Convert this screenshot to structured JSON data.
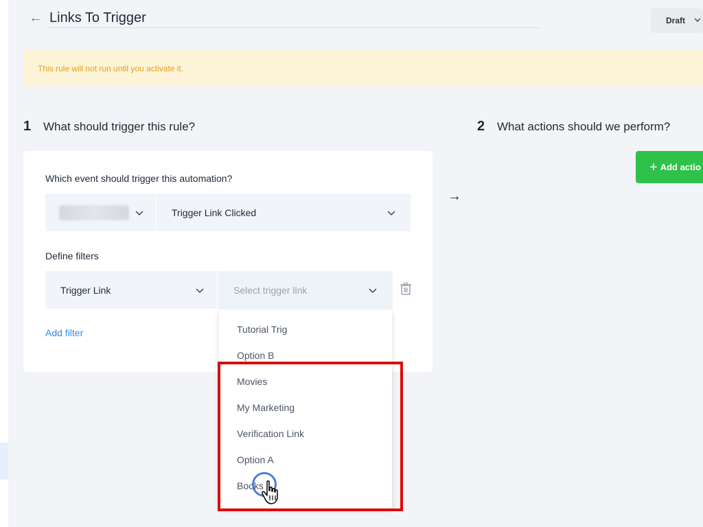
{
  "header": {
    "title": "Links To Trigger",
    "status": {
      "selected": "Draft"
    }
  },
  "banner": {
    "text": "This rule will not run until you activate it."
  },
  "step1": {
    "number": "1",
    "title": "What should trigger this rule?",
    "event_label": "Which event should trigger this automation?",
    "event_select": {
      "selected": "Trigger Link Clicked"
    },
    "filters_label": "Define filters",
    "filter": {
      "field": "Trigger Link",
      "value_placeholder": "Select trigger link"
    },
    "add_filter": "Add filter"
  },
  "step2": {
    "number": "2",
    "title": "What actions should we perform?",
    "add_action": "Add actio"
  },
  "dropdown": {
    "items": [
      "Tutorial Trig",
      "Option B",
      "Movies",
      "My Marketing",
      "Verification Link",
      "Option A",
      "Books"
    ]
  },
  "colors": {
    "accent_blue": "#2d8fe6",
    "banner_bg": "#fdf3d7",
    "banner_text": "#e5a21a",
    "add_action_green": "#2fc24a",
    "highlight_red": "#dd0c0c"
  }
}
